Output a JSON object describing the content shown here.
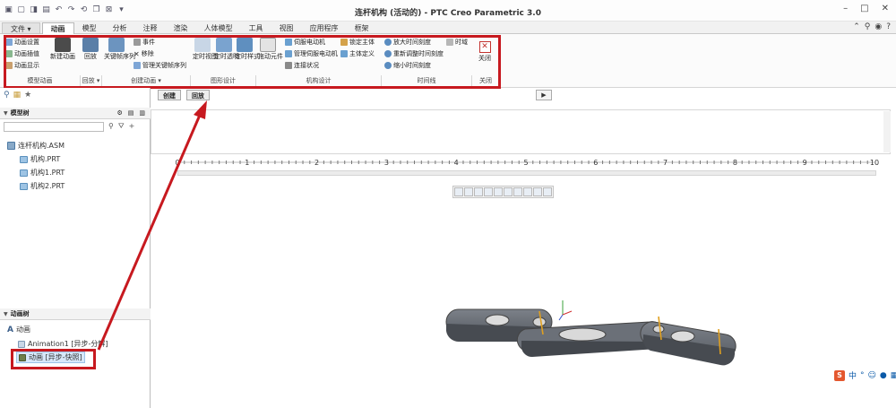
{
  "window": {
    "title": "连杆机构 (活动的) - PTC Creo Parametric 3.0"
  },
  "menubar": {
    "file": "文件",
    "tabs": [
      {
        "label": "动画",
        "active": true
      },
      {
        "label": "模型"
      },
      {
        "label": "分析"
      },
      {
        "label": "注释"
      },
      {
        "label": "渲染"
      },
      {
        "label": "人体模型"
      },
      {
        "label": "工具"
      },
      {
        "label": "视图"
      },
      {
        "label": "应用程序"
      },
      {
        "label": "框架"
      }
    ]
  },
  "ribbon": {
    "model_anim": {
      "settings": "动画设置",
      "interp": "动画插值",
      "display": "动画显示",
      "group": "模型动画"
    },
    "new_anim": "新建动画",
    "playback": {
      "button": "回放",
      "group": "回放"
    },
    "create_anim": {
      "keyframe": "关键帧序列",
      "event": "事件",
      "remove": "移除",
      "manage": "管理关键帧序列",
      "group": "创建动画"
    },
    "graphic_design": {
      "item1": "定时视图",
      "item2": "定时透明",
      "item3": "定时样式",
      "group": "图形设计"
    },
    "mech": {
      "drag": "拖动元件",
      "servo": "伺服电动机",
      "manage_servo": "管理伺服电动机",
      "connect": "连接状况",
      "lock": "锁定主体",
      "body_def": "主体定义",
      "group": "机构设计"
    },
    "timeline": {
      "zoom_in": "放大时间刻度",
      "readjust": "重新调整时间刻度",
      "zoom_out": "缩小时间刻度",
      "timescale": "时域",
      "group": "时间线"
    },
    "close": {
      "button": "关闭",
      "group": "关闭"
    }
  },
  "model_tree": {
    "title": "模型树",
    "items": [
      "连杆机构.ASM",
      "机构.PRT",
      "机构1.PRT",
      "机构2.PRT"
    ]
  },
  "anim_tree": {
    "title": "动画树",
    "root": "动画",
    "items": [
      "Animation1 [异步-分解]",
      "动画 [异步-快照]"
    ]
  },
  "timeline": {
    "create_btn": "创建",
    "playback_btn": "回放",
    "ruler_labels": [
      "0",
      "1",
      "2",
      "3",
      "4",
      "5",
      "6",
      "7",
      "8",
      "9",
      "10"
    ]
  },
  "ime": {
    "lang": "中"
  }
}
